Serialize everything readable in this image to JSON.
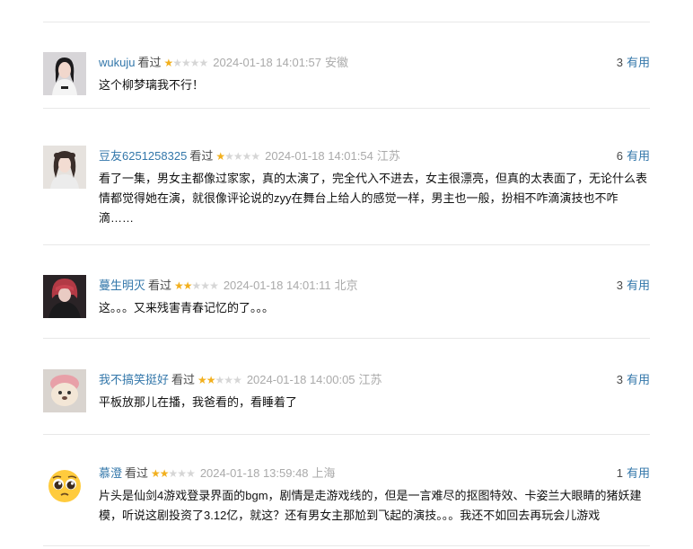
{
  "accent_color": "#3377aa",
  "star_color": "#f2b01e",
  "comments": [
    {
      "user": "wukuju",
      "status": "看过",
      "rating": 1,
      "time": "2024-01-18 14:01:57",
      "location": "安徽",
      "votes": "3",
      "useful": "有用",
      "text": "这个柳梦璃我不行！",
      "avatar_icon": "avatar-photo-woman-white-shirt"
    },
    {
      "user": "豆友6251258325",
      "status": "看过",
      "rating": 1,
      "time": "2024-01-18 14:01:54",
      "location": "江苏",
      "votes": "6",
      "useful": "有用",
      "text": "看了一集，男女主都像过家家，真的太演了，完全代入不进去，女主很漂亮，但真的太表面了，无论什么表情都觉得她在演，就很像评论说的zyy在舞台上给人的感觉一样，男主也一般，扮相不咋滴演技也不咋滴……",
      "avatar_icon": "avatar-photo-girl"
    },
    {
      "user": "蔓生明灭",
      "status": "看过",
      "rating": 2,
      "time": "2024-01-18 14:01:11",
      "location": "北京",
      "votes": "3",
      "useful": "有用",
      "text": "这。。。又来残害青春记忆的了。。。",
      "avatar_icon": "avatar-photo-red-hair"
    },
    {
      "user": "我不搞笑挺好",
      "status": "看过",
      "rating": 2,
      "time": "2024-01-18 14:00:05",
      "location": "江苏",
      "votes": "3",
      "useful": "有用",
      "text": "平板放那儿在播，我爸看的，看睡着了",
      "avatar_icon": "avatar-photo-dog"
    },
    {
      "user": "慕澄",
      "status": "看过",
      "rating": 2,
      "time": "2024-01-18 13:59:48",
      "location": "上海",
      "votes": "1",
      "useful": "有用",
      "text": "片头是仙剑4游戏登录界面的bgm，剧情是走游戏线的，但是一言难尽的抠图特效、卡姿兰大眼睛的猪妖建模，听说这剧投资了3.12亿，就这？还有男女主那尬到飞起的演技。。。我还不如回去再玩会儿游戏",
      "avatar_icon": "pleading-face-emoji-icon"
    }
  ]
}
